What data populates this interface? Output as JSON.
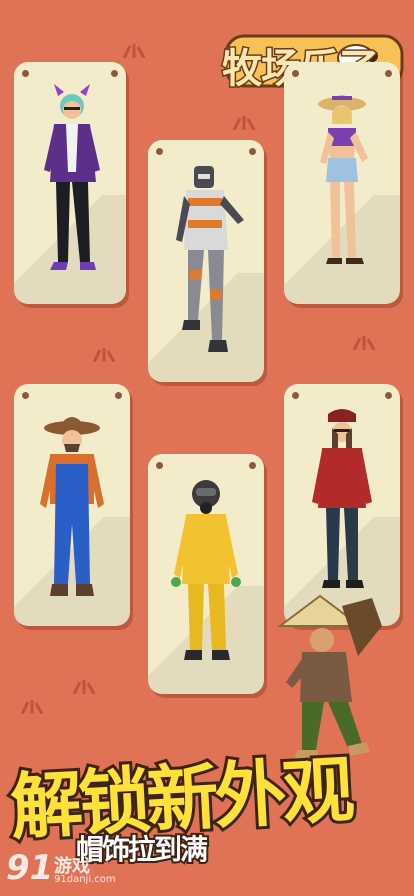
{
  "logo": {
    "title": "牧场乐了"
  },
  "headline": "解锁新外观",
  "subline": "帽饰拉到满",
  "watermark": {
    "number": "91",
    "name": "游戏",
    "url": "91danji.com"
  },
  "characters": [
    {
      "id": "hoodie-girl",
      "icon": "cat-ear-headphones-girl"
    },
    {
      "id": "robot-suit",
      "icon": "robot-armor"
    },
    {
      "id": "straw-hat-girl",
      "icon": "summer-girl"
    },
    {
      "id": "cowboy-farmer",
      "icon": "farmer-overalls"
    },
    {
      "id": "hazmat-suit",
      "icon": "yellow-hazmat"
    },
    {
      "id": "red-jacket-girl",
      "icon": "red-hoodie-girl"
    }
  ],
  "colors": {
    "background": "#e07356",
    "card": "#f3eccb",
    "headline": "#ffe13a",
    "outline": "#3d2414"
  }
}
